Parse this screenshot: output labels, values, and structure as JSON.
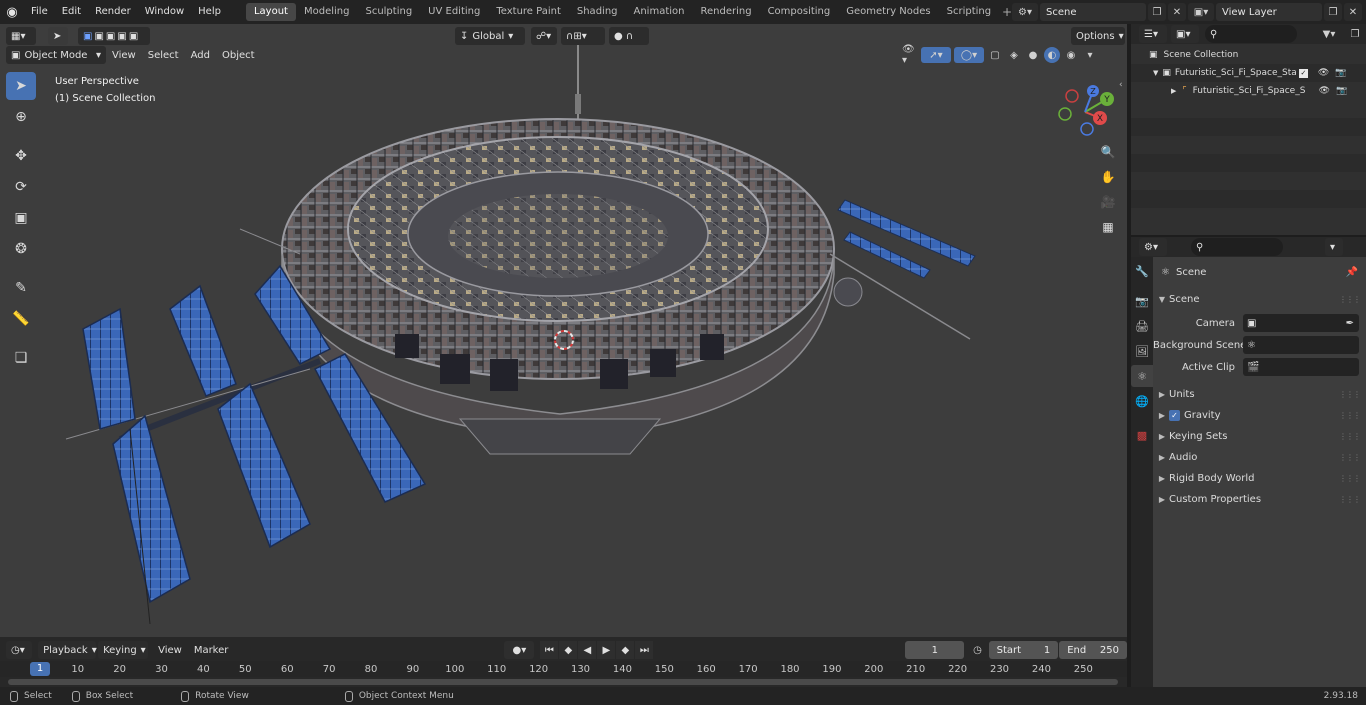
{
  "menubar": {
    "menus": [
      "File",
      "Edit",
      "Render",
      "Window",
      "Help"
    ],
    "workspaces": [
      "Layout",
      "Modeling",
      "Sculpting",
      "UV Editing",
      "Texture Paint",
      "Shading",
      "Animation",
      "Rendering",
      "Compositing",
      "Geometry Nodes",
      "Scripting"
    ],
    "active_workspace": "Layout",
    "scene_name": "Scene",
    "view_layer": "View Layer"
  },
  "viewport": {
    "mode": "Object Mode",
    "menus": [
      "View",
      "Select",
      "Add",
      "Object"
    ],
    "orientation": "Global",
    "options_label": "Options",
    "overlay_title": "User Perspective",
    "overlay_subtitle": "(1) Scene Collection",
    "gizmo_axes": {
      "x": "X",
      "y": "Y",
      "z": "Z"
    }
  },
  "toolbar": {
    "tools": [
      "select-box",
      "cursor",
      "move",
      "rotate",
      "scale",
      "transform",
      "annotate",
      "measure",
      "add-cube"
    ],
    "active_tool": "select-box"
  },
  "timeline": {
    "menus": [
      "Playback",
      "Keying",
      "View",
      "Marker"
    ],
    "current_frame": "1",
    "start_label": "Start",
    "start_value": "1",
    "end_label": "End",
    "end_value": "250",
    "ruler_labels": [
      "10",
      "20",
      "30",
      "40",
      "50",
      "60",
      "70",
      "80",
      "90",
      "100",
      "110",
      "120",
      "130",
      "140",
      "150",
      "160",
      "170",
      "180",
      "190",
      "200",
      "210",
      "220",
      "230",
      "240",
      "250"
    ],
    "ruler_current": "1"
  },
  "statusbar": {
    "select": "Select",
    "box_select": "Box Select",
    "rotate_view": "Rotate View",
    "context_menu": "Object Context Menu",
    "version": "2.93.18"
  },
  "outliner": {
    "root": "Scene Collection",
    "collection": "Futuristic_Sci_Fi_Space_Statio",
    "object": "Futuristic_Sci_Fi_Space_S"
  },
  "properties": {
    "context_title": "Scene",
    "panel_title": "Scene",
    "camera_label": "Camera",
    "background_label": "Background Scene",
    "active_clip_label": "Active Clip",
    "subpanels": [
      "Units",
      "Gravity",
      "Keying Sets",
      "Audio",
      "Rigid Body World",
      "Custom Properties"
    ],
    "gravity_checked": true
  }
}
